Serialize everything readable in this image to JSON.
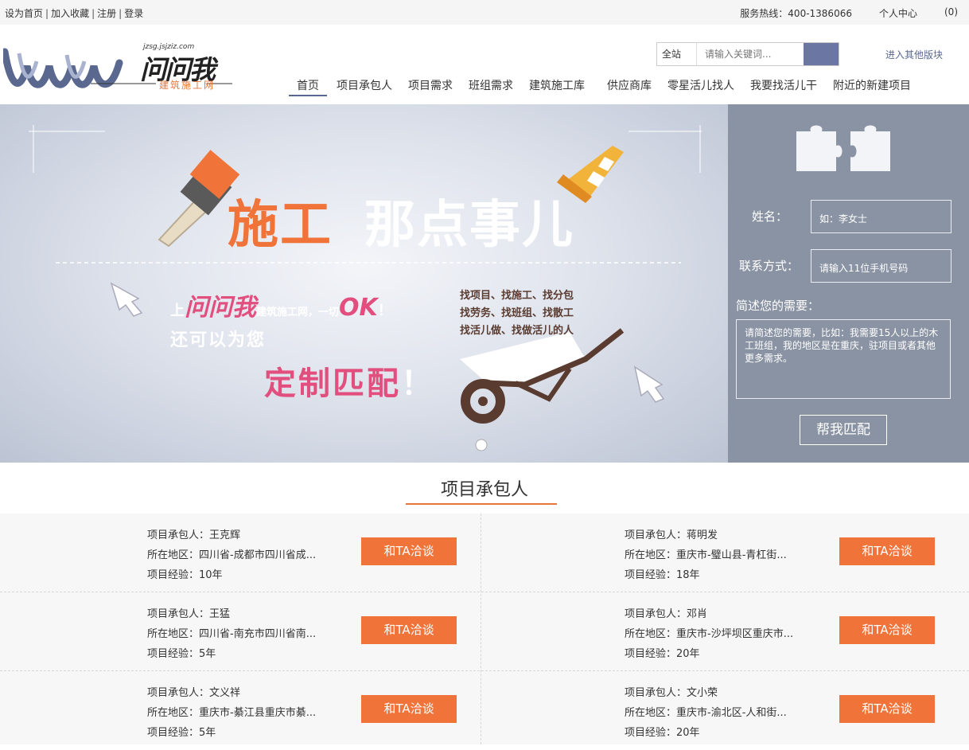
{
  "topbar": {
    "set_home": "设为首页",
    "favorite": "加入收藏",
    "register": "注册",
    "login": "登录",
    "hotline": "服务热线：400-1386066",
    "user_center": "个人中心",
    "cart_count": "(0)"
  },
  "header": {
    "logo_text": "问问我",
    "logo_domain": "jzsg.jsjziz.com",
    "logo_sub": "建筑施工网",
    "search_scope": "全站",
    "search_placeholder": "请输入关键词...",
    "other_link": "进入其他版块"
  },
  "nav": [
    {
      "label": "首页"
    },
    {
      "label": "项目承包人"
    },
    {
      "label": "项目需求"
    },
    {
      "label": "班组需求"
    },
    {
      "label": "建筑施工库"
    },
    {
      "label": "供应商库"
    },
    {
      "label": "零星活儿找人"
    },
    {
      "label": "我要找活儿干"
    },
    {
      "label": "附近的新建项目"
    }
  ],
  "banner": {
    "headline_1": "施工",
    "headline_2": "那点事儿",
    "line1_pre": "上",
    "line1_brand": "问问我",
    "line1_mid": "建筑施工网，一切",
    "line1_ok": "OK",
    "line1_end": "！",
    "line2": "还可以为您",
    "line3": "定制匹配",
    "line3_end": "！",
    "find_1": "找项目、找施工、找分包",
    "find_2": "找劳务、找班组、找散工",
    "find_3": "找活儿做、找做活儿的人"
  },
  "form": {
    "name_label": "姓名：",
    "name_placeholder": "如：李女士",
    "contact_label": "联系方式：",
    "contact_placeholder": "请输入11位手机号码",
    "need_label": "简述您的需要：",
    "need_placeholder": "请简述您的需要，比如：我需要15人以上的木工班组，我的地区是在重庆，驻项目或者其他更多需求。",
    "submit": "帮我匹配"
  },
  "section": {
    "title": "项目承包人"
  },
  "contractors": [
    {
      "name": "项目承包人：王克辉",
      "area": "所在地区：四川省-成都市四川省成...",
      "exp": "项目经验：10年",
      "btn": "和TA洽谈"
    },
    {
      "name": "项目承包人：蒋明发",
      "area": "所在地区：重庆市-璧山县-青杠街...",
      "exp": "项目经验：18年",
      "btn": "和TA洽谈"
    },
    {
      "name": "项目承包人：王猛",
      "area": "所在地区：四川省-南充市四川省南...",
      "exp": "项目经验：5年",
      "btn": "和TA洽谈"
    },
    {
      "name": "项目承包人：邓肖",
      "area": "所在地区：重庆市-沙坪坝区重庆市...",
      "exp": "项目经验：20年",
      "btn": "和TA洽谈"
    },
    {
      "name": "项目承包人：文义祥",
      "area": "所在地区：重庆市-綦江县重庆市綦...",
      "exp": "项目经验：5年",
      "btn": "和TA洽谈"
    },
    {
      "name": "项目承包人：文小荣",
      "area": "所在地区：重庆市-渝北区-人和街...",
      "exp": "项目经验：20年",
      "btn": "和TA洽谈"
    }
  ],
  "colors": {
    "accent_orange": "#f0743a",
    "brand_blue": "#5a6890",
    "form_panel": "#8a93a3"
  }
}
